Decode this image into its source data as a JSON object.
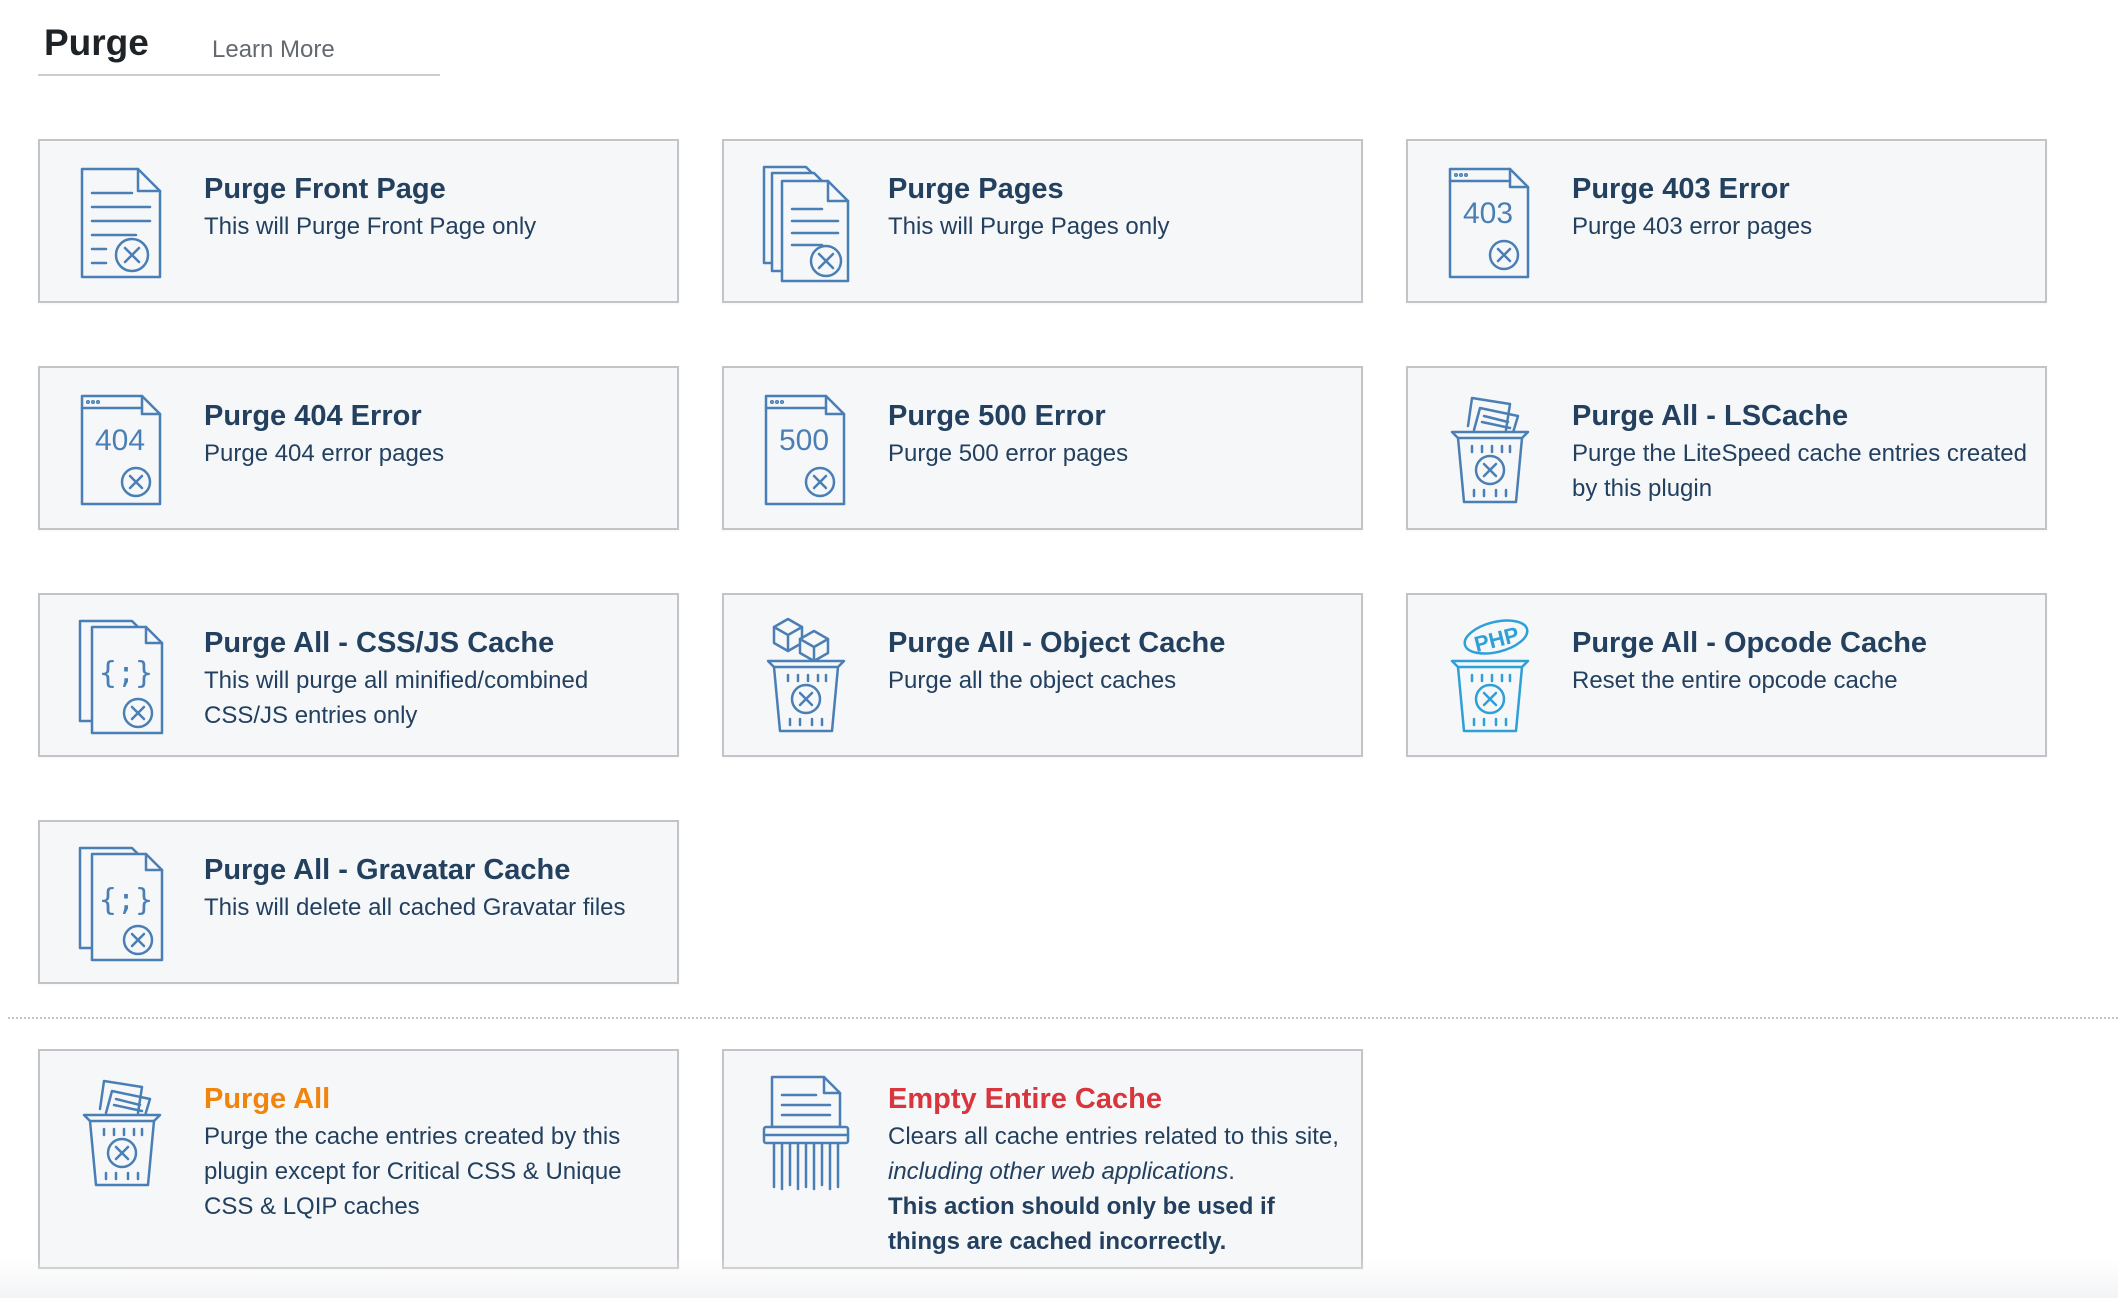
{
  "header": {
    "title": "Purge",
    "learn_more": "Learn More"
  },
  "cards": [
    {
      "title": "Purge Front Page",
      "desc": "This will Purge Front Page only",
      "icon": "purge-front-page-icon"
    },
    {
      "title": "Purge Pages",
      "desc": "This will Purge Pages only",
      "icon": "purge-pages-icon"
    },
    {
      "title": "Purge 403 Error",
      "desc": "Purge 403 error pages",
      "icon": "error-403-icon",
      "icon_label": "403"
    },
    {
      "title": "Purge 404 Error",
      "desc": "Purge 404 error pages",
      "icon": "error-404-icon",
      "icon_label": "404"
    },
    {
      "title": "Purge 500 Error",
      "desc": "Purge 500 error pages",
      "icon": "error-500-icon",
      "icon_label": "500"
    },
    {
      "title": "Purge All - LSCache",
      "desc": "Purge the LiteSpeed cache entries created by this plugin",
      "icon": "trash-bin-icon"
    },
    {
      "title": "Purge All - CSS/JS Cache",
      "desc": "This will purge all minified/combined CSS/JS entries only",
      "icon": "code-files-icon",
      "icon_label": "{;}"
    },
    {
      "title": "Purge All - Object Cache",
      "desc": "Purge all the object caches",
      "icon": "object-cache-bin-icon"
    },
    {
      "title": "Purge All - Opcode Cache",
      "desc": "Reset the entire opcode cache",
      "icon": "php-bin-icon",
      "icon_label": "PHP"
    },
    {
      "title": "Purge All - Gravatar Cache",
      "desc": "This will delete all cached Gravatar files",
      "icon": "code-files-icon",
      "icon_label": "{;}"
    },
    {
      "title": "Purge All",
      "desc": "Purge the cache entries created by this plugin except for Critical CSS & Unique CSS & LQIP caches",
      "icon": "trash-bin-icon"
    },
    {
      "title": "Empty Entire Cache",
      "desc_prefix": "Clears all cache entries related to this site, ",
      "desc_italic": "including other web applications",
      "desc_suffix": ".",
      "desc_bold": "This action should only be used if things are cached incorrectly.",
      "icon": "shredder-icon"
    }
  ],
  "colors": {
    "icon_blue": "#4a7fb5",
    "php_blue": "#2f9fd8",
    "title_navy": "#23405f",
    "purge_all_orange": "#f0840c",
    "empty_cache_red": "#d6363c",
    "card_bg": "#f6f7f9",
    "card_border": "#c3c4c7"
  }
}
